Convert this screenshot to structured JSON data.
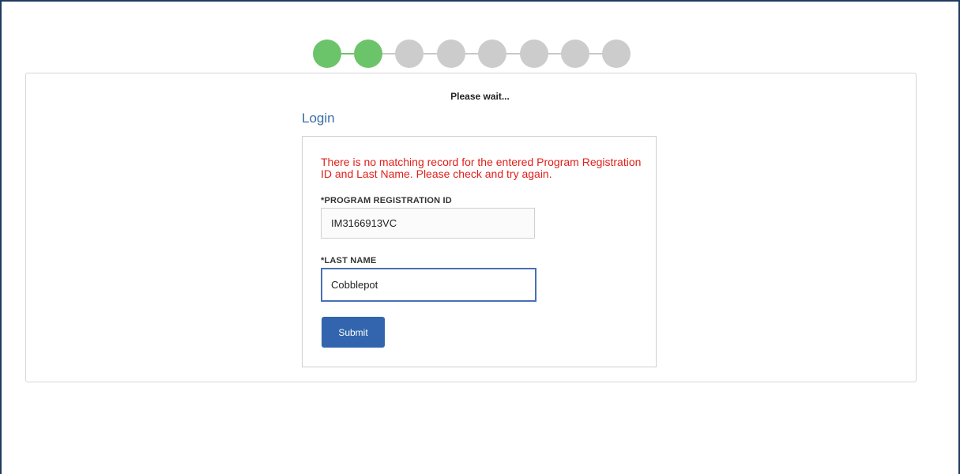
{
  "stepper": {
    "total_steps": 8,
    "completed_steps": 2
  },
  "status": {
    "text": "Please wait..."
  },
  "login": {
    "title": "Login",
    "error": "There is no matching record for the entered Program Registration ID and Last Name. Please check and try again.",
    "registration_id_label": "*PROGRAM REGISTRATION ID",
    "registration_id_value": "IM3166913VC",
    "last_name_label": "*LAST NAME",
    "last_name_value": "Cobblepot",
    "submit_label": "Submit"
  },
  "colors": {
    "step_complete": "#6cc46a",
    "step_pending": "#cccccc",
    "title_blue": "#3a6ea5",
    "error_red": "#e0201b",
    "button_blue": "#3265ad",
    "focus_border": "#4a6fb3"
  }
}
